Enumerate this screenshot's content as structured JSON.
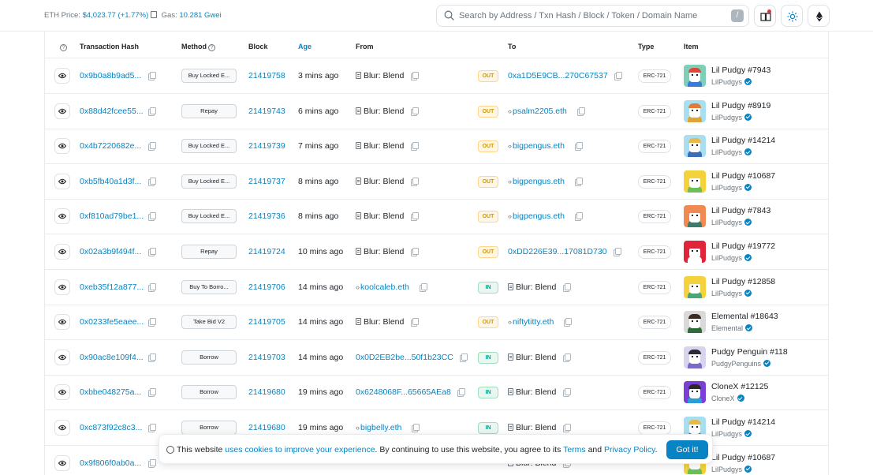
{
  "topbar": {
    "eth_price_label": "ETH Price:",
    "eth_price_value": "$4,023.77 (+1.77%)",
    "gas_label": "Gas:",
    "gas_value": "10.281 Gwei",
    "search_placeholder": "Search by Address / Txn Hash / Block / Token / Domain Name",
    "search_shortcut": "/",
    "icons": [
      "book-icon",
      "sun-icon",
      "ethereum-icon"
    ]
  },
  "table": {
    "headers": {
      "help": "?",
      "hash": "Transaction Hash",
      "method": "Method",
      "block": "Block",
      "age": "Age",
      "from": "From",
      "to": "To",
      "type": "Type",
      "item": "Item"
    },
    "rows": [
      {
        "hash": "0x9b0a8b9ad5...",
        "method": "Buy Locked E...",
        "block": "21419758",
        "age": "3 mins ago",
        "from": "Blur: Blend",
        "from_kind": "contract-doc",
        "dir": "OUT",
        "to": "0xa1D5E9CB...270C67537",
        "to_kind": "address",
        "type": "ERC-721",
        "item": "Lil Pudgy #7943",
        "collection": "LilPudgys",
        "thumb_bg": "#7fcfb8",
        "thumb_hat": "#e0463c",
        "thumb_body": "#3a7bd5"
      },
      {
        "hash": "0x88d42fcee55...",
        "method": "Repay",
        "block": "21419743",
        "age": "6 mins ago",
        "from": "Blur: Blend",
        "from_kind": "contract-doc",
        "dir": "OUT",
        "to": "psalm2205.eth",
        "to_kind": "ens",
        "type": "ERC-721",
        "item": "Lil Pudgy #8919",
        "collection": "LilPudgys",
        "thumb_bg": "#a8dff0",
        "thumb_hat": "#e07b39",
        "thumb_body": "#e0a339"
      },
      {
        "hash": "0x4b7220682e...",
        "method": "Buy Locked E...",
        "block": "21419739",
        "age": "7 mins ago",
        "from": "Blur: Blend",
        "from_kind": "contract-doc",
        "dir": "OUT",
        "to": "bigpengus.eth",
        "to_kind": "ens",
        "type": "ERC-721",
        "item": "Lil Pudgy #14214",
        "collection": "LilPudgys",
        "thumb_bg": "#a8dff0",
        "thumb_hat": "#e7b84a",
        "thumb_body": "#3b6fb8"
      },
      {
        "hash": "0xb5fb40a1d3f...",
        "method": "Buy Locked E...",
        "block": "21419737",
        "age": "8 mins ago",
        "from": "Blur: Blend",
        "from_kind": "contract-doc",
        "dir": "OUT",
        "to": "bigpengus.eth",
        "to_kind": "ens",
        "type": "ERC-721",
        "item": "Lil Pudgy #10687",
        "collection": "LilPudgys",
        "thumb_bg": "#f4d23c",
        "thumb_hat": "#f4d23c",
        "thumb_body": "#6bbf59"
      },
      {
        "hash": "0xf810ad79be1...",
        "method": "Buy Locked E...",
        "block": "21419736",
        "age": "8 mins ago",
        "from": "Blur: Blend",
        "from_kind": "contract-doc",
        "dir": "OUT",
        "to": "bigpengus.eth",
        "to_kind": "ens",
        "type": "ERC-721",
        "item": "Lil Pudgy #7843",
        "collection": "LilPudgys",
        "thumb_bg": "#ef8a52",
        "thumb_hat": "#ef8a52",
        "thumb_body": "#3d7b6e"
      },
      {
        "hash": "0x02a3b9f494f...",
        "method": "Repay",
        "block": "21419724",
        "age": "10 mins ago",
        "from": "Blur: Blend",
        "from_kind": "contract-doc",
        "dir": "OUT",
        "to": "0xDD226E39...17081D730",
        "to_kind": "address",
        "type": "ERC-721",
        "item": "Lil Pudgy #19772",
        "collection": "LilPudgys",
        "thumb_bg": "#e0243a",
        "thumb_hat": "#e0243a",
        "thumb_body": "#ffffff"
      },
      {
        "hash": "0xeb35f12a877...",
        "method": "Buy To Borro...",
        "block": "21419706",
        "age": "14 mins ago",
        "from": "koolcaleb.eth",
        "from_kind": "ens",
        "dir": "IN",
        "to": "Blur: Blend",
        "to_kind": "contract-doc",
        "type": "ERC-721",
        "item": "Lil Pudgy #12858",
        "collection": "LilPudgys",
        "thumb_bg": "#f4d23c",
        "thumb_hat": "#f4d23c",
        "thumb_body": "#4aa57a"
      },
      {
        "hash": "0x0233fe5eaee...",
        "method": "Take Bid V2",
        "block": "21419705",
        "age": "14 mins ago",
        "from": "Blur: Blend",
        "from_kind": "contract-doc",
        "dir": "OUT",
        "to": "niftytitty.eth",
        "to_kind": "ens",
        "type": "ERC-721",
        "item": "Elemental #18643",
        "collection": "Elemental",
        "thumb_bg": "#d9d9d9",
        "thumb_hat": "#3a2a22",
        "thumb_body": "#2e6b3a"
      },
      {
        "hash": "0x90ac8e109f4...",
        "method": "Borrow",
        "block": "21419703",
        "age": "14 mins ago",
        "from": "0x0D2EB2be...50f1b23CC",
        "from_kind": "address",
        "dir": "IN",
        "to": "Blur: Blend",
        "to_kind": "contract-doc",
        "type": "ERC-721",
        "item": "Pudgy Penguin #118",
        "collection": "PudgyPenguins",
        "thumb_bg": "#d8d4ee",
        "thumb_hat": "#2b2b3a",
        "thumb_body": "#7a6bc9"
      },
      {
        "hash": "0xbbe048275a...",
        "method": "Borrow",
        "block": "21419680",
        "age": "19 mins ago",
        "from": "0x6248068F...65665AEa8",
        "from_kind": "address",
        "dir": "IN",
        "to": "Blur: Blend",
        "to_kind": "contract-doc",
        "type": "ERC-721",
        "item": "CloneX #12125",
        "collection": "CloneX",
        "thumb_bg": "#7b3fd6",
        "thumb_hat": "#2a2a2a",
        "thumb_body": "#2d9bd6"
      },
      {
        "hash": "0xc873f92c8c3...",
        "method": "Borrow",
        "block": "21419680",
        "age": "19 mins ago",
        "from": "bigbelly.eth",
        "from_kind": "ens",
        "dir": "IN",
        "to": "Blur: Blend",
        "to_kind": "contract-doc",
        "type": "ERC-721",
        "item": "Lil Pudgy #14214",
        "collection": "LilPudgys",
        "thumb_bg": "#a8dff0",
        "thumb_hat": "#e7b84a",
        "thumb_body": "#3b6fb8"
      },
      {
        "hash": "0x9f806f0ab0a...",
        "method": "",
        "block": "",
        "age": "",
        "from": "",
        "from_kind": "ens",
        "dir": "",
        "to": "Blur: Blend",
        "to_kind": "contract-doc",
        "type": "",
        "item": "Lil Pudgy #10687",
        "collection": "LilPudgys",
        "thumb_bg": "#f4d23c",
        "thumb_hat": "#f4d23c",
        "thumb_body": "#6bbf59"
      }
    ]
  },
  "cookie_banner": {
    "text_before": "This website ",
    "link1": "uses cookies to improve your experience",
    "text_mid": ". By continuing to use this website, you agree to its ",
    "link2": "Terms",
    "text_and": " and ",
    "link3": "Privacy Policy",
    "text_end": ".",
    "button": "Got it!"
  },
  "colors": {
    "link": "#0784c3",
    "out_badge": "#cc9a06",
    "in_badge": "#00a186"
  }
}
